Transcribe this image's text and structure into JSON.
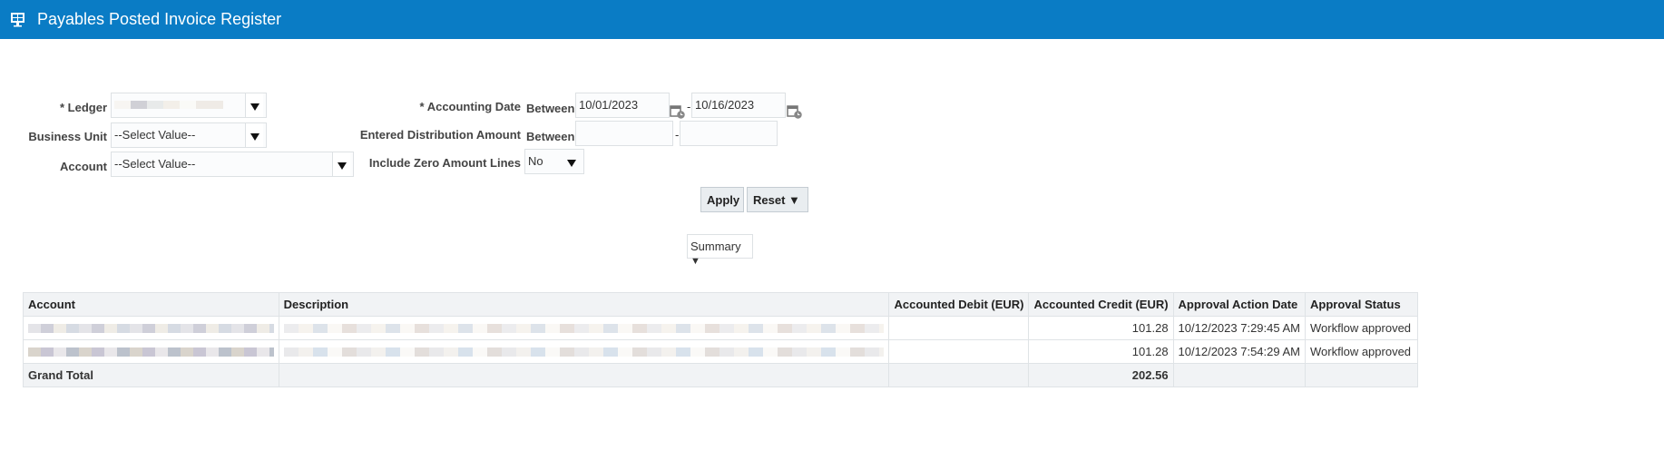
{
  "header": {
    "title": "Payables Posted Invoice Register",
    "icon": "report-monitor-icon"
  },
  "filters": {
    "ledger": {
      "label": "* Ledger",
      "value": ""
    },
    "business_unit": {
      "label": "Business Unit",
      "value": "--Select Value--"
    },
    "account": {
      "label": "Account",
      "value": "--Select Value--"
    },
    "accounting_date": {
      "label": "* Accounting Date",
      "between": "Between",
      "from": "10/01/2023",
      "to": "10/16/2023",
      "dash": "-"
    },
    "entered_amount": {
      "label": "Entered Distribution Amount",
      "between": "Between",
      "from": "",
      "to": "",
      "dash": "-"
    },
    "zero_lines": {
      "label": "Include Zero Amount Lines",
      "value": "No"
    }
  },
  "buttons": {
    "apply": "Apply",
    "reset": "Reset"
  },
  "view": {
    "value": "Summary"
  },
  "table": {
    "columns": [
      "Account",
      "Description",
      "Accounted Debit (EUR)",
      "Accounted Credit (EUR)",
      "Approval Action Date",
      "Approval Status"
    ],
    "rows": [
      {
        "debit": "",
        "credit": "101.28",
        "date": "10/12/2023 7:29:45 AM",
        "status": "Workflow approved"
      },
      {
        "debit": "",
        "credit": "101.28",
        "date": "10/12/2023 7:54:29 AM",
        "status": "Workflow approved"
      }
    ],
    "total": {
      "label": "Grand Total",
      "credit": "202.56"
    }
  },
  "colors": {
    "header": "#0a7cc5"
  }
}
